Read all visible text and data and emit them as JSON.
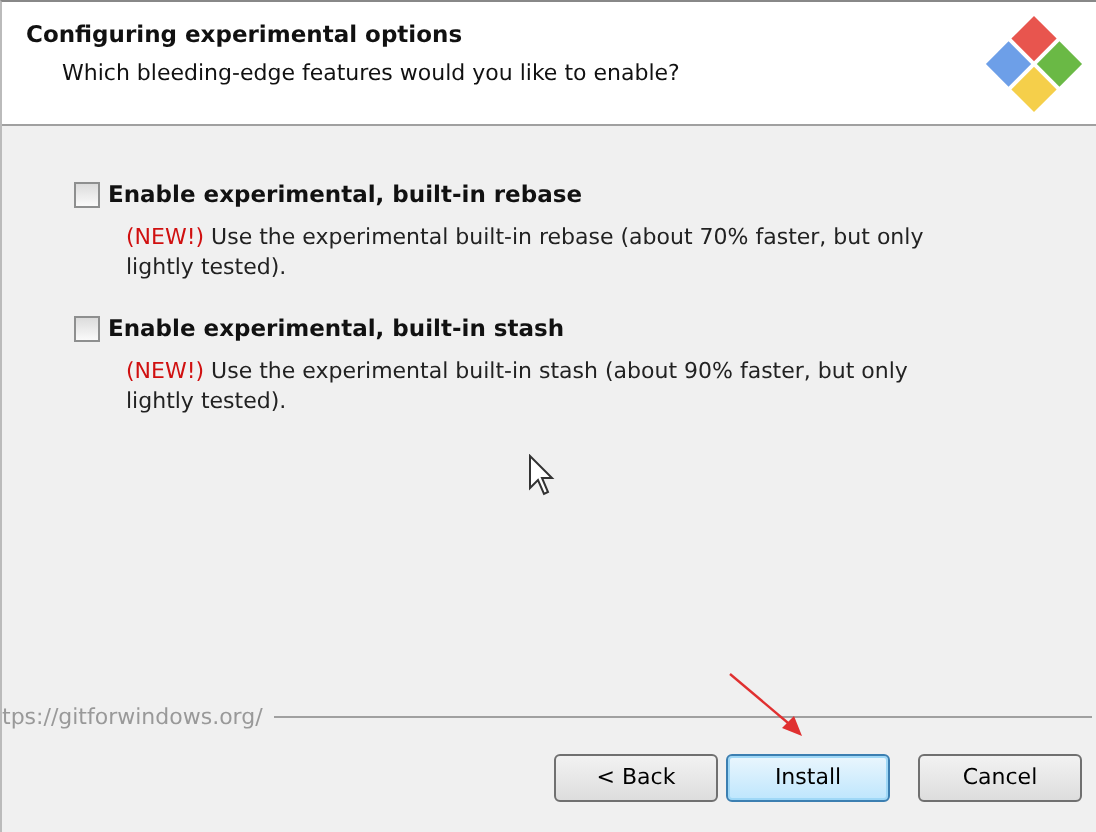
{
  "header": {
    "title": "Configuring experimental options",
    "subtitle": "Which bleeding-edge features would you like to enable?"
  },
  "options": [
    {
      "label": "Enable experimental, built-in rebase",
      "checked": false,
      "tag": "(NEW!)",
      "description": "Use the experimental built-in rebase (about 70% faster, but only lightly tested)."
    },
    {
      "label": "Enable experimental, built-in stash",
      "checked": false,
      "tag": "(NEW!)",
      "description": "Use the experimental built-in stash (about 90% faster, but only lightly tested)."
    }
  ],
  "footer": {
    "url": "tps://gitforwindows.org/"
  },
  "buttons": [
    {
      "label": "< Back",
      "default": false
    },
    {
      "label": "Install",
      "default": true
    },
    {
      "label": "Cancel",
      "default": false
    }
  ]
}
